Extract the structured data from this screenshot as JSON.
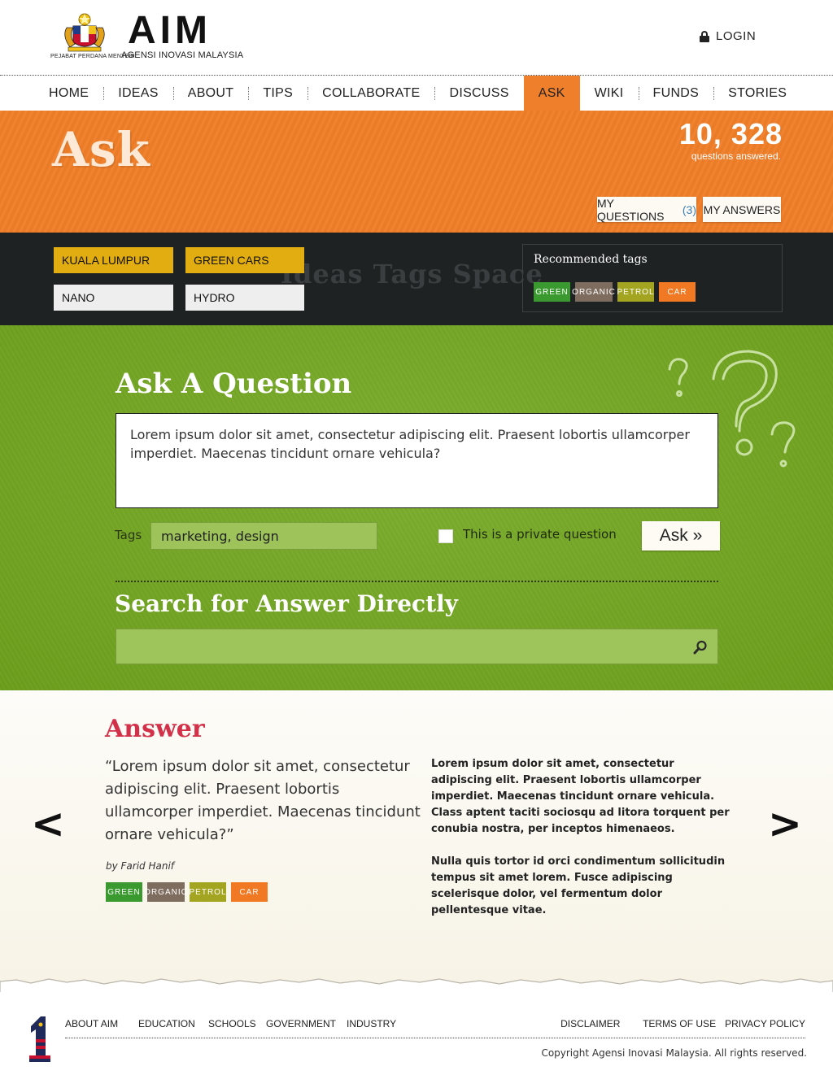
{
  "header": {
    "brand": "AIM",
    "brand_subtitle": "AGENSI INOVASI MALAYSIA",
    "crest_caption": "PEJABAT PERDANA MENTERI",
    "login_label": "LOGIN"
  },
  "nav": {
    "items": [
      "HOME",
      "IDEAS",
      "ABOUT",
      "TIPS",
      "COLLABORATE",
      "DISCUSS",
      "ASK",
      "WIKI",
      "FUNDS",
      "STORIES"
    ],
    "active": "ASK"
  },
  "banner": {
    "title": "Ask",
    "stat_number": "10, 328",
    "stat_label": "questions answered.",
    "my_questions_label": "MY QUESTIONS",
    "my_questions_count": "(3)",
    "my_answers_label": "MY ANSWERS",
    "color": "#ef7e29"
  },
  "tag_strip": {
    "watermark": "Ideas Tags Space",
    "chips": [
      "KUALA LUMPUR",
      "GREEN CARS",
      "NANO",
      "HYDRO"
    ],
    "recommended_title": "Recommended tags",
    "recommended_tags": [
      "GREEN",
      "ORGANIC",
      "PETROL",
      "CAR"
    ]
  },
  "ask": {
    "title": "Ask A Question",
    "question_text": "Lorem ipsum dolor sit amet, consectetur adipiscing elit. Praesent lobortis ullamcorper imperdiet. Maecenas tincidunt ornare vehicula?",
    "tags_label": "Tags",
    "tags_value": "marketing, design",
    "private_label": "This is a private question",
    "private_checked": false,
    "ask_button": "Ask »",
    "search_title": "Search for Answer Directly",
    "search_value": ""
  },
  "answer": {
    "title": "Answer",
    "quote": "“Lorem ipsum dolor sit amet, consectetur adipiscing elit. Praesent lobortis ullamcorper imperdiet. Maecenas tincidunt ornare vehicula?”",
    "byline": "by Farid Hanif",
    "tags": [
      "GREEN",
      "ORGANIC",
      "PETROL",
      "CAR"
    ],
    "body_p1": "Lorem ipsum dolor sit amet, consectetur adipiscing elit. Praesent lobortis ullamcorper imperdiet. Maecenas tincidunt ornare vehicula. Class aptent taciti sociosqu ad litora torquent per conubia nostra, per inceptos himenaeos.",
    "body_p2": "Nulla quis tortor id orci condimentum sollicitudin tempus sit amet lorem. Fusce adipiscing scelerisque dolor, vel fermentum dolor pellentesque vitae.",
    "prev_arrow": "<",
    "next_arrow": ">"
  },
  "footer": {
    "links_left": [
      "ABOUT AIM",
      "EDUCATION",
      "SCHOOLS",
      "GOVERNMENT",
      "INDUSTRY"
    ],
    "links_right": [
      "DISCLAIMER",
      "TERMS OF USE",
      "PRIVACY POLICY"
    ],
    "copyright": "Copyright Agensi Inovasi Malaysia. All rights reserved."
  },
  "colors": {
    "orange": "#ef7e29",
    "green_section": "#72a71e",
    "answer_title": "#d3304a",
    "tag_green": "#3a9a2f",
    "tag_brown": "#7e6c5e",
    "tag_olive": "#a3a420",
    "tag_orange": "#f27924"
  }
}
